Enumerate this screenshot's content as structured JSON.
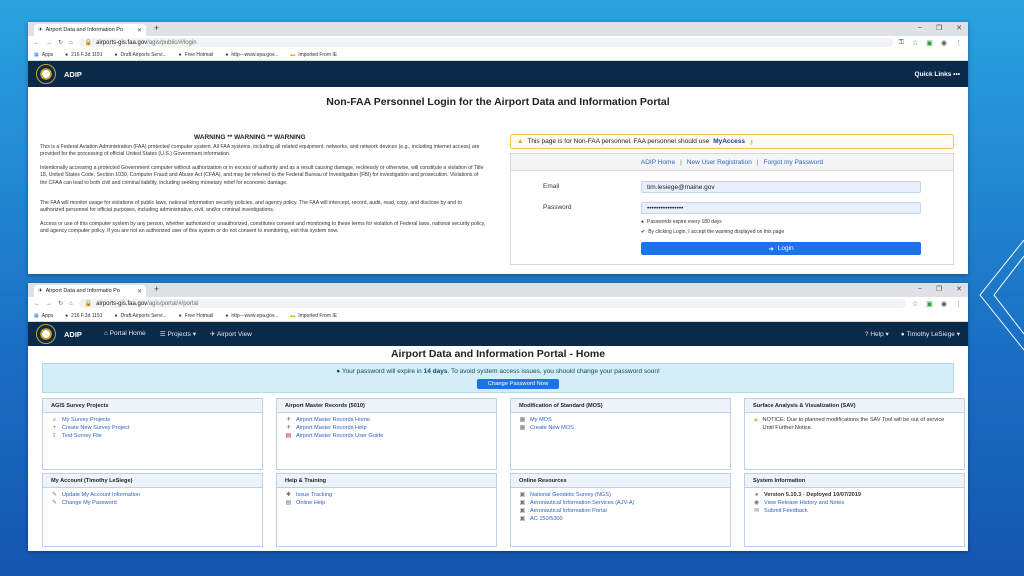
{
  "window1": {
    "tab_title": "Airport Data and Information Po",
    "url_host": "airports-gis.faa.gov",
    "url_path": "/agis/public/#/login",
    "bookmarks": [
      "Apps",
      "216 F.3d 1191",
      "Draft Airports Servi...",
      "Free Hotmail",
      "http---www.epa.gov...",
      "Imported From IE"
    ],
    "nav_brand": "ADIP",
    "quick_links": "Quick Links •••",
    "page_title": "Non-FAA Personnel Login for the Airport Data and Information Portal",
    "warning_heading": "WARNING ** WARNING ** WARNING",
    "warning_paragraphs": [
      "This is a Federal Aviation Administration (FAA) protected computer system. All FAA systems, including all related equipment, networks, and network devices (e.g., including internet access) are provided for the processing of official United States (U.S.) Government information.",
      "Intentionally accessing a protected Government computer without authorization or in excess of authority and as a result causing damage, recklessly or otherwise, will constitute a violation of Title 18, United States Code, Section 1030, Computer Fraud and Abuse Act (CFAA), and may be referred to the Federal Bureau of Investigation (FBI) for investigation and prosecution. Violations of the CFAA can lead to both civil and criminal liability, including seeking monetary relief for economic damage.",
      "The FAA will monitor usage for violations of public laws, national information security policies, and agency policy. The FAA will intercept, record, audit, read, copy, and disclose by and to authorized personnel for official purposes, including administrative, civil, and/or criminal investigations.",
      "Access or use of this computer system by any person, whether authorized or unauthorized, constitutes consent and monitoring to these terms for violation of Federal laws, national security policy, and agency computer policy. If you are not an authorized user of this system or do not consent to monitoring, exit this system now."
    ],
    "alert_text": "This page is for Non-FAA personnel. FAA personnel should use",
    "alert_link": "MyAccess",
    "panel_links": [
      "ADIP Home",
      "New User Registration",
      "Forgot my Password"
    ],
    "email_label": "Email",
    "email_value": "tim.lesiege@maine.gov",
    "password_label": "Password",
    "password_value": "••••••••••••••••",
    "note_expire": "Passwords expire every 180 days",
    "note_accept": "By clicking Login, I accept the warning displayed on this page",
    "login_button": "Login"
  },
  "window2": {
    "tab_title": "Airport Data and Informatio Po",
    "url_host": "airports-gis.faa.gov",
    "url_path": "/agis/portal/#/portal",
    "bookmarks": [
      "Apps",
      "216 F.3d 1191",
      "Draft Airports Servi...",
      "Free Hotmail",
      "http---www.epa.gov...",
      "Imported From IE"
    ],
    "nav_brand": "ADIP",
    "nav_links": [
      "Portal Home",
      "Projects ▾",
      "Airport View"
    ],
    "nav_help": "Help ▾",
    "nav_user": "Timothy LeSiege ▾",
    "page_title": "Airport Data and Information Portal - Home",
    "pw_msg_pre": "Your password will expire in",
    "pw_days": "14 days",
    "pw_msg_post": ". To avoid system access issues, you should change your password soon!",
    "pw_button": "Change Password Now",
    "cards": [
      {
        "title": "AGIS Survey Projects",
        "items": [
          "My Survey Projects",
          "Create New Survey Project",
          "Test Survey File"
        ]
      },
      {
        "title": "Airport Master Records (5010)",
        "items": [
          "Airport Master Records Home",
          "Airport Master Records Help",
          "Airport Master Records User Guide"
        ]
      },
      {
        "title": "Modification of Standard (MOS)",
        "items": [
          "My MOS",
          "Create New MOS"
        ]
      },
      {
        "title": "Surface Analysis & Visualization (SAV)",
        "notice": "NOTICE: Due to planned modifications the SAV Tool will be out of service Until Further Notice."
      },
      {
        "title": "My Account (Timothy LeSiege)",
        "items": [
          "Update My Account Information",
          "Change My Password"
        ]
      },
      {
        "title": "Help & Training",
        "items": [
          "Issue Tracking",
          "Online Help"
        ]
      },
      {
        "title": "Online Resources",
        "items": [
          "National Geodetic Survey (NGS)",
          "Aeronautical Information Services (AJV-A)",
          "Aeronautical Information Portal",
          "AC 150/5300"
        ]
      },
      {
        "title": "System Information",
        "version": "Version 5.10.3 - Deployed 10/07/2019",
        "items": [
          "View Release History and Notes",
          "Submit Feedback"
        ]
      }
    ]
  }
}
